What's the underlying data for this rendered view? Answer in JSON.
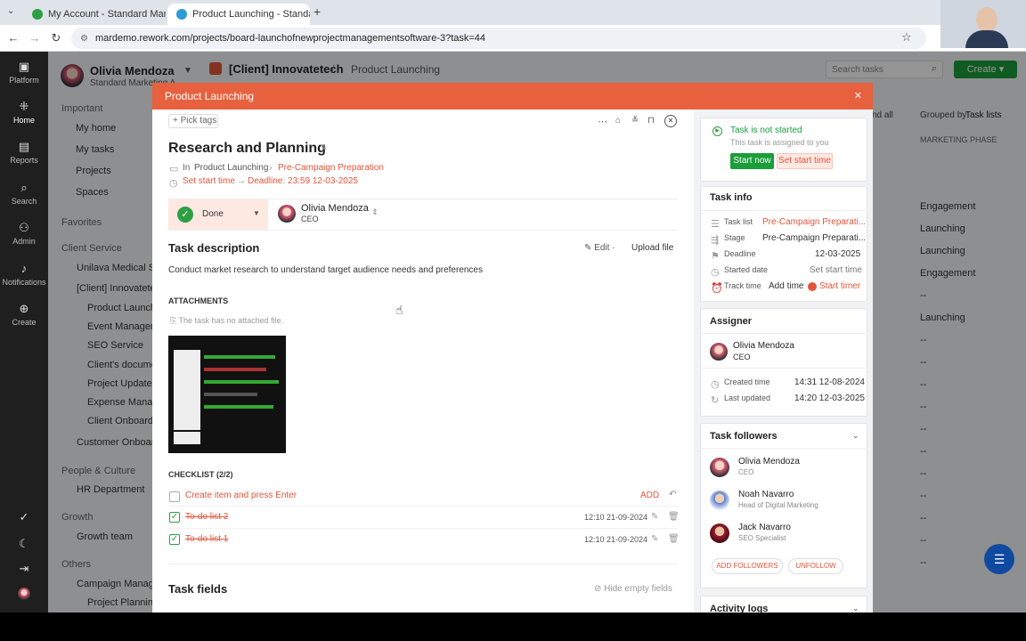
{
  "browser": {
    "tabs": [
      {
        "title": "My Account - Standard Marketi",
        "active": false
      },
      {
        "title": "Product Launching - Standard M",
        "active": true
      }
    ],
    "new_tab": "+",
    "url": "mardemo.rework.com/projects/board-launchofnewprojectmanagementsoftware-3?task=44"
  },
  "rail": [
    {
      "label": "Platform",
      "icon": "platform-icon"
    },
    {
      "label": "Home",
      "icon": "home-icon"
    },
    {
      "label": "Reports",
      "icon": "reports-icon"
    },
    {
      "label": "Search",
      "icon": "search-icon"
    },
    {
      "label": "Admin",
      "icon": "admin-icon"
    },
    {
      "label": "Notifications",
      "icon": "bell-icon"
    },
    {
      "label": "Create",
      "icon": "plus-icon"
    }
  ],
  "sidebar": {
    "user_name": "Olivia Mendoza",
    "user_sub": "Standard Marketing A",
    "important_heading": "Important",
    "important": [
      "My home",
      "My tasks",
      "Projects",
      "Spaces"
    ],
    "favorites_heading": "Favorites",
    "client_service_heading": "Client Service",
    "client_service": [
      "Unilava Medical Ser",
      "[Client] Innovatetec"
    ],
    "client_sub": [
      "Product Launchin",
      "Event Managem",
      "SEO Service",
      "Client's document",
      "Project Update",
      "Expense Manage",
      "Client Onboardin"
    ],
    "customer_onboarding": "Customer Onboardin",
    "people_heading": "People & Culture",
    "hr": "HR Department",
    "growth_heading": "Growth",
    "growth_team": "Growth team",
    "others_heading": "Others",
    "campaign": "Campaign Managem",
    "project_planning": "Project Planning"
  },
  "header": {
    "project": "[Client] Innovatetech",
    "separator": "/",
    "board": "Product Launching",
    "search_placeholder": "Search tasks",
    "create_label": "Create",
    "expand_all": "nd all",
    "grouped_by_label": "Grouped by:",
    "grouped_by_value": "Task lists",
    "column_header": "MARKETING PHASE",
    "column_values": [
      "Engagement",
      "Launching",
      "Launching",
      "Engagement",
      "--",
      "Launching",
      "--",
      "--",
      "--",
      "--",
      "--",
      "--",
      "--",
      "--",
      "--",
      "--",
      "--"
    ]
  },
  "modal": {
    "title": "Product Launching",
    "pick_tags": "Pick tags",
    "task_title": "Research and Planning",
    "in_label": "In",
    "in_project": "Product Launching",
    "in_list": "Pre-Campaign Preparation",
    "set_start_time": "Set start time",
    "deadline_text": "Deadline: 23:59 12-03-2025",
    "status": "Done",
    "assignee_name": "Olivia Mendoza",
    "assignee_role": "CEO",
    "description_heading": "Task description",
    "edit_label": "Edit",
    "upload_label": "Upload file",
    "description": "Conduct market research to understand target audience needs and preferences",
    "attachments_heading": "ATTACHMENTS",
    "no_file": "The task has no attached file.",
    "checklist_heading": "CHECKLIST (2/2)",
    "checklist_placeholder": "Create item and press Enter",
    "checklist_add": "ADD",
    "checklist": [
      {
        "text": "To-do list 2",
        "time": "12:10 21-09-2024"
      },
      {
        "text": "To-do list 1",
        "time": "12:10 21-09-2024"
      }
    ],
    "fields_heading": "Task fields",
    "hide_empty": "Hide empty fields"
  },
  "status_card": {
    "title": "Task is not started",
    "sub": "This task is assigned to you",
    "start_now": "Start now",
    "set_start": "Set start time"
  },
  "task_info": {
    "heading": "Task info",
    "rows": [
      {
        "label": "Task list",
        "value": "Pre-Campaign Preparati...",
        "accent": true
      },
      {
        "label": "Stage",
        "value": "Pre-Campaign Preparati...",
        "accent": false
      },
      {
        "label": "Deadline",
        "value": "12-03-2025",
        "accent": false
      },
      {
        "label": "Started date",
        "value": "Set start time",
        "accent": false
      }
    ],
    "track_label": "Track time",
    "add_time": "Add time",
    "start_timer": "Start timer"
  },
  "assigner": {
    "heading": "Assigner",
    "name": "Olivia Mendoza",
    "role": "CEO",
    "created_label": "Created time",
    "created_value": "14:31 12-08-2024",
    "updated_label": "Last updated",
    "updated_value": "14:20 12-03-2025"
  },
  "followers": {
    "heading": "Task followers",
    "list": [
      {
        "name": "Olivia Mendoza",
        "role": "CEO"
      },
      {
        "name": "Noah Navarro",
        "role": "Head of Digital Marketing"
      },
      {
        "name": "Jack Navarro",
        "role": "SEO Specialist"
      }
    ],
    "add": "ADD FOLLOWERS",
    "unfollow": "UNFOLLOW"
  },
  "activity": {
    "heading": "Activity logs"
  },
  "colors": {
    "accent": "#e8613e",
    "green": "#1a9e3a",
    "dark": "#1f1f1f"
  }
}
